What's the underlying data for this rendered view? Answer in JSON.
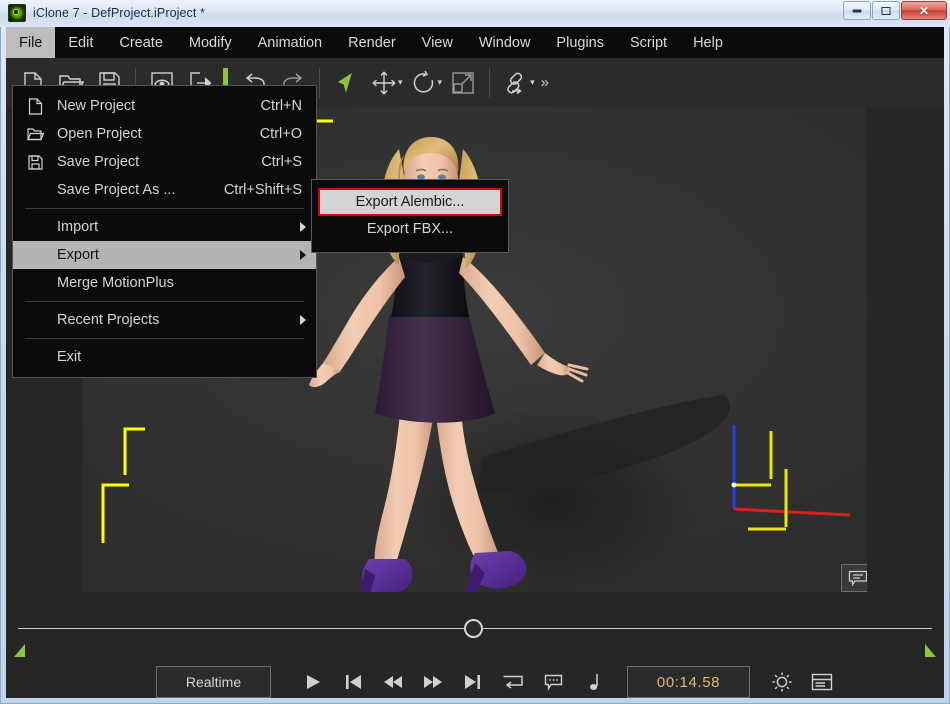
{
  "window": {
    "title": "iClone 7 - DefProject.iProject *",
    "app_icon": "iclone-logo-icon",
    "controls": {
      "minimize": "minimize-icon",
      "maximize": "maximize-icon",
      "close": "✕"
    }
  },
  "menubar": {
    "items": [
      {
        "label": "File",
        "active": true
      },
      {
        "label": "Edit",
        "active": false
      },
      {
        "label": "Create",
        "active": false
      },
      {
        "label": "Modify",
        "active": false
      },
      {
        "label": "Animation",
        "active": false
      },
      {
        "label": "Render",
        "active": false
      },
      {
        "label": "View",
        "active": false
      },
      {
        "label": "Window",
        "active": false
      },
      {
        "label": "Plugins",
        "active": false
      },
      {
        "label": "Script",
        "active": false
      },
      {
        "label": "Help",
        "active": false
      }
    ]
  },
  "toolbar": {
    "buttons": [
      {
        "name": "new-project-icon",
        "tip": "New Project"
      },
      {
        "name": "open-project-icon",
        "tip": "Open Project"
      },
      {
        "name": "save-project-icon",
        "tip": "Save Project"
      },
      {
        "name": "preview-icon",
        "tip": "Preview"
      },
      {
        "name": "export-icon",
        "tip": "Export"
      },
      {
        "name": "undo-icon",
        "tip": "Undo"
      },
      {
        "name": "redo-icon",
        "tip": "Redo"
      },
      {
        "name": "select-tool-icon",
        "tip": "Select"
      },
      {
        "name": "move-tool-icon",
        "tip": "Move"
      },
      {
        "name": "rotate-tool-icon",
        "tip": "Rotate"
      },
      {
        "name": "scale-tool-icon",
        "tip": "Scale"
      },
      {
        "name": "link-tool-icon",
        "tip": "Link"
      }
    ],
    "overflow_label": "»",
    "accent_color": "#8cc63e"
  },
  "file_menu": {
    "items": [
      {
        "label": "New Project",
        "accel": "Ctrl+N",
        "icon": "new-file-icon",
        "submenu": false,
        "highlight": false
      },
      {
        "label": "Open Project",
        "accel": "Ctrl+O",
        "icon": "open-folder-icon",
        "submenu": false,
        "highlight": false
      },
      {
        "label": "Save Project",
        "accel": "Ctrl+S",
        "icon": "floppy-disk-icon",
        "submenu": false,
        "highlight": false
      },
      {
        "label": "Save Project As ...",
        "accel": "Ctrl+Shift+S",
        "icon": "",
        "submenu": false,
        "highlight": false
      },
      {
        "label": "Import",
        "accel": "",
        "icon": "",
        "submenu": true,
        "highlight": false
      },
      {
        "label": "Export",
        "accel": "",
        "icon": "",
        "submenu": true,
        "highlight": true
      },
      {
        "label": "Merge MotionPlus",
        "accel": "",
        "icon": "",
        "submenu": false,
        "highlight": false
      },
      {
        "label": "Recent Projects",
        "accel": "",
        "icon": "",
        "submenu": true,
        "highlight": false
      },
      {
        "label": "Exit",
        "accel": "",
        "icon": "",
        "submenu": false,
        "highlight": false
      }
    ]
  },
  "export_submenu": {
    "items": [
      {
        "label": "Export Alembic...",
        "selected": true
      },
      {
        "label": "Export FBX...",
        "selected": false
      }
    ],
    "highlight_border_color": "#e00000"
  },
  "viewport": {
    "background": "#333333",
    "note_button": "comment-note-icon",
    "gizmo": {
      "x_axis_color": "#d92020",
      "y_axis_color": "#e8e800",
      "z_axis_color": "#2040e0"
    },
    "selection_bracket_color": "#ffff00"
  },
  "timeline": {
    "playhead_position_pct": 49,
    "range_start_marker": "range-start-marker",
    "range_end_marker": "range-end-marker"
  },
  "transport": {
    "mode_label": "Realtime",
    "timecode": "00:14.58",
    "buttons": [
      {
        "name": "play-button",
        "glyph": "play"
      },
      {
        "name": "jump-to-start-button",
        "glyph": "skip-back"
      },
      {
        "name": "rewind-button",
        "glyph": "rewind"
      },
      {
        "name": "fast-forward-button",
        "glyph": "forward"
      },
      {
        "name": "jump-to-end-button",
        "glyph": "skip-forward"
      },
      {
        "name": "loop-button",
        "glyph": "loop"
      },
      {
        "name": "subtitle-button",
        "glyph": "bubble"
      },
      {
        "name": "audio-note-button",
        "glyph": "note"
      }
    ],
    "right_buttons": [
      {
        "name": "preview-settings-button",
        "glyph": "gear"
      },
      {
        "name": "timeline-panel-button",
        "glyph": "panel"
      }
    ]
  }
}
